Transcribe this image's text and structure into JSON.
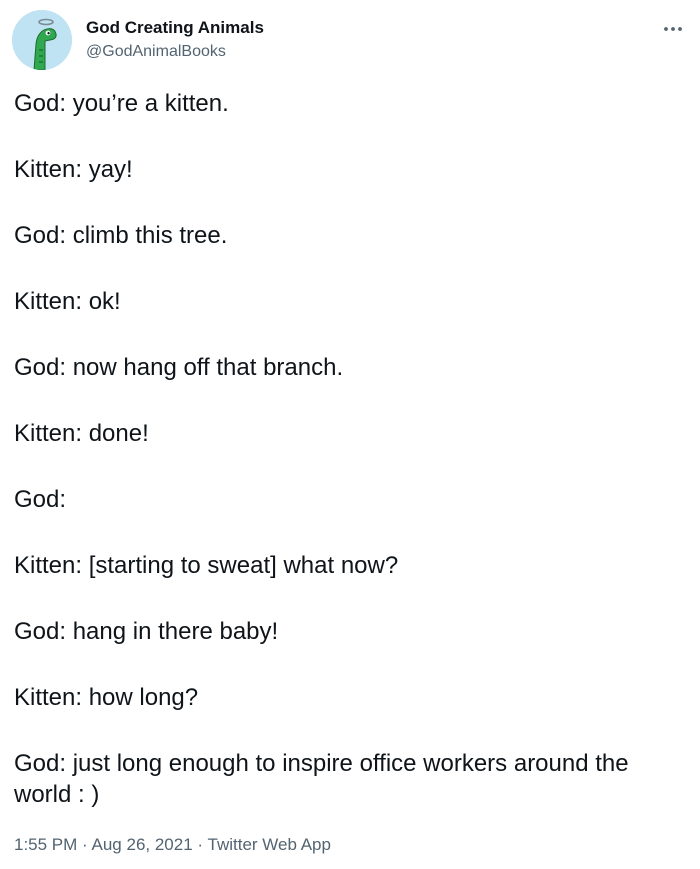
{
  "author": {
    "display_name": "God Creating Animals",
    "handle": "@GodAnimalBooks",
    "avatar_icon": "green-dinosaur-avatar"
  },
  "menu": {
    "icon": "more-options-icon"
  },
  "tweet": {
    "lines": [
      "God: you’re a kitten.",
      "Kitten: yay!",
      "God: climb this tree.",
      "Kitten: ok!",
      "God: now hang off that branch.",
      "Kitten: done!",
      "God:",
      "Kitten: [starting to sweat] what now?",
      "God: hang in there baby!",
      "Kitten: how long?",
      "God: just long enough to inspire office workers around the world : )"
    ]
  },
  "footer": {
    "time": "1:55 PM",
    "date": "Aug 26, 2021",
    "client": "Twitter Web App",
    "separator": "·"
  },
  "colors": {
    "text": "#0f1419",
    "secondary": "#536471",
    "avatar_bg": "#bfe3f2",
    "avatar_dino": "#2fa84f"
  }
}
